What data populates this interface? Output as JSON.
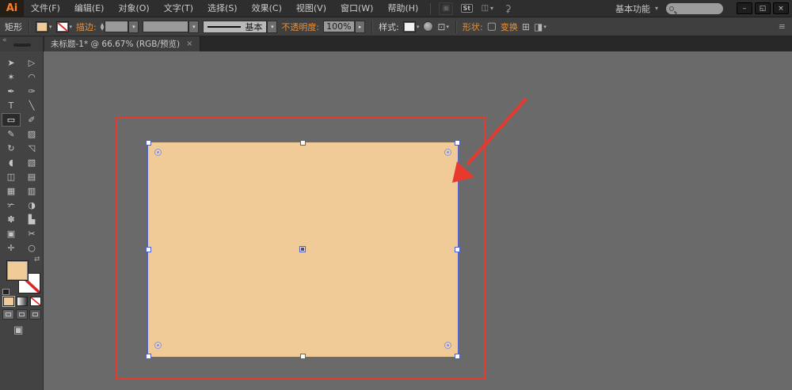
{
  "window": {
    "logo": "Ai",
    "st_badge": "St",
    "workspace": "基本功能",
    "workspace_caret": "▾",
    "minimize": "–",
    "restore": "◱",
    "close": "×"
  },
  "menubar": {
    "menus": [
      "文件(F)",
      "编辑(E)",
      "对象(O)",
      "文字(T)",
      "选择(S)",
      "效果(C)",
      "视图(V)",
      "窗口(W)",
      "帮助(H)"
    ]
  },
  "controlbar": {
    "tool_label": "矩形",
    "stroke_label": "描边:",
    "stroke_style_label": "基本",
    "opacity_label": "不透明度:",
    "opacity_value": "100%",
    "opacity_arrow": "▸",
    "style_label": "样式:",
    "shape_label": "形状:",
    "transform_label": "变换",
    "panel_menu": "≡"
  },
  "tabbar": {
    "collapse": "«",
    "title": "未标题-1* @ 66.67% (RGB/预览)",
    "close": "×"
  },
  "toolbar": {
    "tools": [
      {
        "name": "selection",
        "glyph": "➤"
      },
      {
        "name": "direct-selection",
        "glyph": "▷"
      },
      {
        "name": "magic-wand",
        "glyph": "✶"
      },
      {
        "name": "lasso",
        "glyph": "◠"
      },
      {
        "name": "pen",
        "glyph": "✒"
      },
      {
        "name": "curvature",
        "glyph": "✑"
      },
      {
        "name": "type",
        "glyph": "T"
      },
      {
        "name": "line-segment",
        "glyph": "╲"
      },
      {
        "name": "rectangle",
        "glyph": "▭"
      },
      {
        "name": "paintbrush",
        "glyph": "✐"
      },
      {
        "name": "pencil",
        "glyph": "✎"
      },
      {
        "name": "eraser",
        "glyph": "▨"
      },
      {
        "name": "rotate",
        "glyph": "↻"
      },
      {
        "name": "scale",
        "glyph": "◹"
      },
      {
        "name": "width",
        "glyph": "◖"
      },
      {
        "name": "free-transform",
        "glyph": "▧"
      },
      {
        "name": "shape-builder",
        "glyph": "◫"
      },
      {
        "name": "perspective-grid",
        "glyph": "▤"
      },
      {
        "name": "mesh",
        "glyph": "▦"
      },
      {
        "name": "gradient",
        "glyph": "▥"
      },
      {
        "name": "eyedropper",
        "glyph": "✃"
      },
      {
        "name": "blend",
        "glyph": "◑"
      },
      {
        "name": "symbol-sprayer",
        "glyph": "✽"
      },
      {
        "name": "column-graph",
        "glyph": "▙"
      },
      {
        "name": "artboard",
        "glyph": "▣"
      },
      {
        "name": "slice",
        "glyph": "✂"
      },
      {
        "name": "hand",
        "glyph": "✛"
      },
      {
        "name": "zoom",
        "glyph": "○"
      }
    ],
    "swap_glyph": "⇄",
    "screen_mode_glyph": "▣"
  },
  "canvas": {
    "fill_color": "#f0cb98",
    "selection_color": "#5666cf",
    "annotation_color": "#e8392f"
  }
}
